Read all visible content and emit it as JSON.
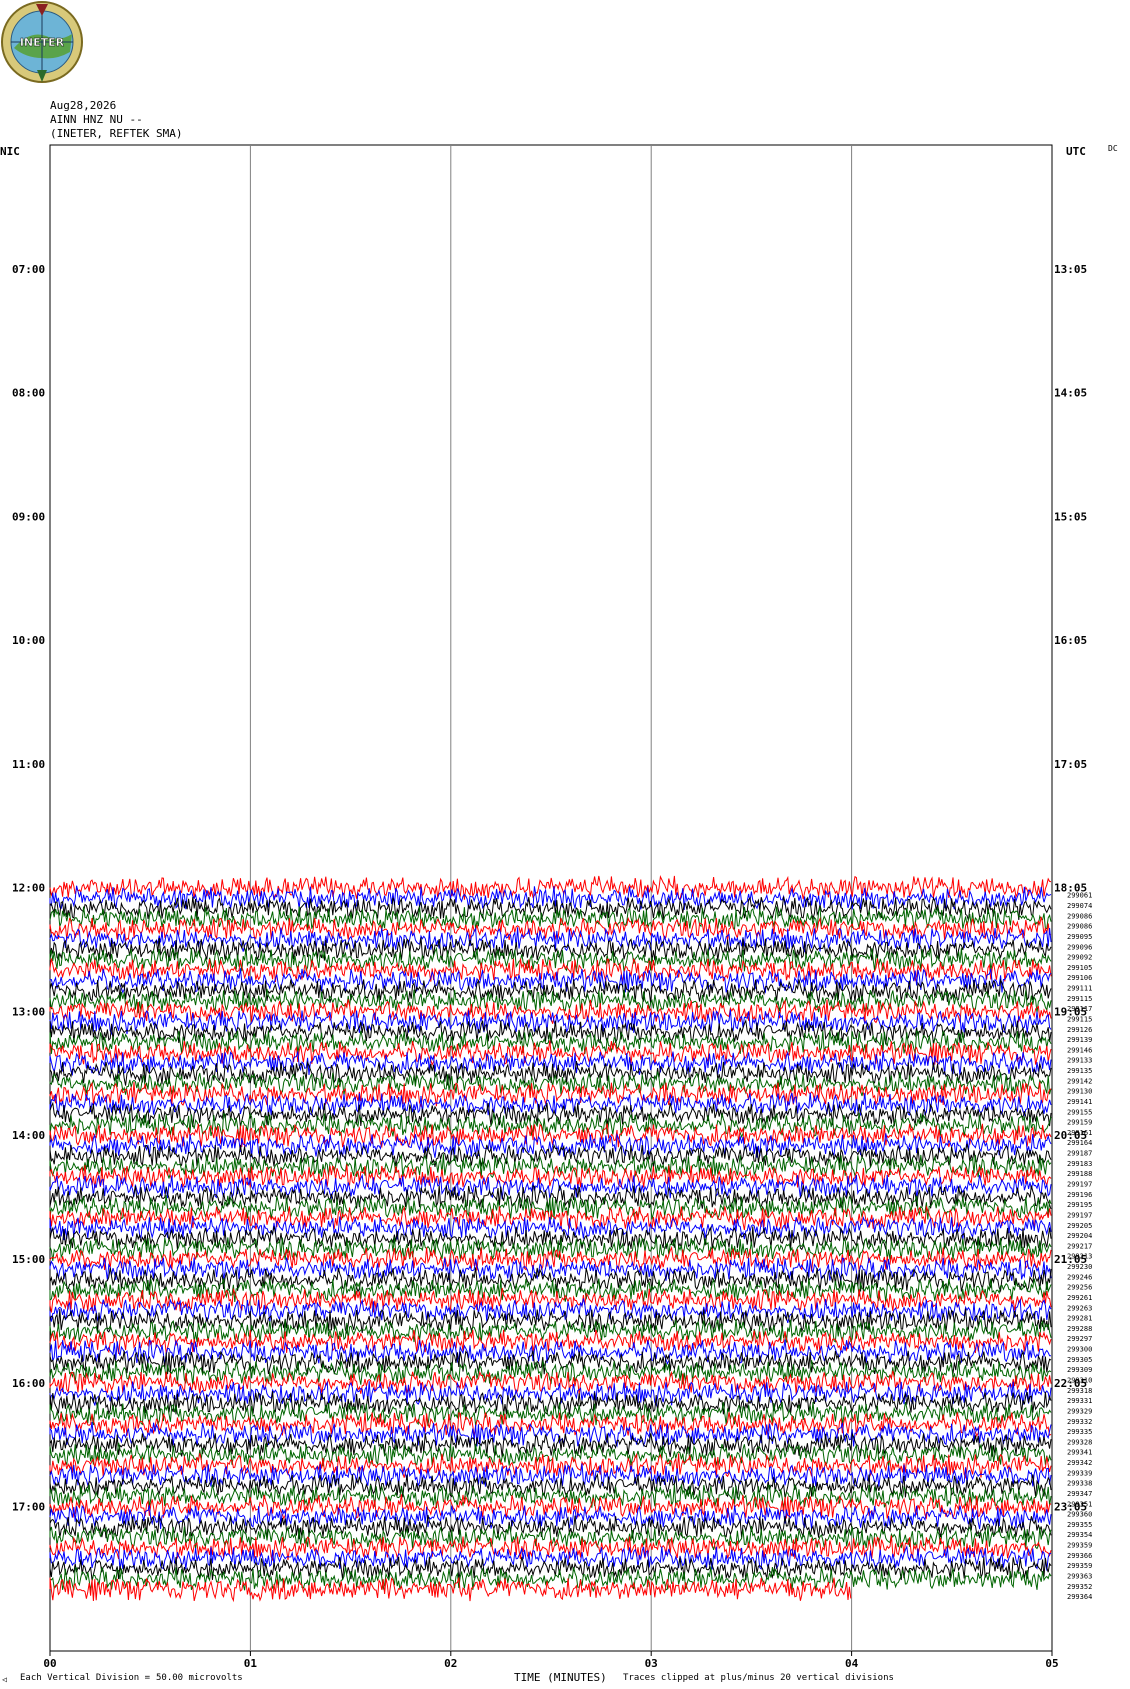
{
  "logo": {
    "text": "INETER"
  },
  "header": {
    "date": "Aug28,2026",
    "station": "AINN HNZ NU --",
    "network": "(INETER, REFTEK SMA)"
  },
  "left_tz": "NIC",
  "right_tz": "UTC",
  "dc_label": "DC",
  "footer": {
    "division_label": "Each Vertical Division =",
    "division_value": "50.00 microvolts",
    "clip_note": "Traces clipped at plus/minus 20 vertical divisions",
    "corner_mark": "◁"
  },
  "colors": {
    "red": "#ff0000",
    "blue": "#0000ff",
    "black": "#000000",
    "green": "#006400",
    "grid": "#808080"
  },
  "chart_data": {
    "type": "line",
    "xlabel": "TIME (MINUTES)",
    "xlim": [
      0,
      5
    ],
    "x_ticks": [
      "00",
      "01",
      "02",
      "03",
      "04",
      "05"
    ],
    "left_time_labels": [
      "07:00",
      "08:00",
      "09:00",
      "10:00",
      "11:00",
      "12:00",
      "13:00",
      "14:00",
      "15:00",
      "16:00",
      "17:00"
    ],
    "right_time_labels": [
      "13:05",
      "14:05",
      "15:05",
      "16:05",
      "17:05",
      "18:05",
      "19:05",
      "20:05",
      "21:05",
      "22:05",
      "23:05"
    ],
    "time_axis": {
      "start": "06:00",
      "end": "18:10",
      "minutes_per_trace": 5
    },
    "data_start": "12:00",
    "trace_color_cycle": [
      "red",
      "blue",
      "black",
      "green"
    ],
    "last_trace_end_minute": 4,
    "trace_values": [
      "299061",
      "299074",
      "299086",
      "299086",
      "299095",
      "299096",
      "299092",
      "299105",
      "299106",
      "299111",
      "299115",
      "299117",
      "299115",
      "299126",
      "299139",
      "299146",
      "299133",
      "299135",
      "299142",
      "299130",
      "299141",
      "299155",
      "299159",
      "299161",
      "299164",
      "299187",
      "299183",
      "299188",
      "299197",
      "299196",
      "299195",
      "299197",
      "299205",
      "299204",
      "299217",
      "299213",
      "299230",
      "299246",
      "299256",
      "299261",
      "299263",
      "299281",
      "299288",
      "299297",
      "299300",
      "299305",
      "299309",
      "299310",
      "299318",
      "299331",
      "299329",
      "299332",
      "299335",
      "299328",
      "299341",
      "299342",
      "299339",
      "299338",
      "299347",
      "299351",
      "299360",
      "299355",
      "299354",
      "299359",
      "299366",
      "299359",
      "299363",
      "299352",
      "299364"
    ]
  }
}
